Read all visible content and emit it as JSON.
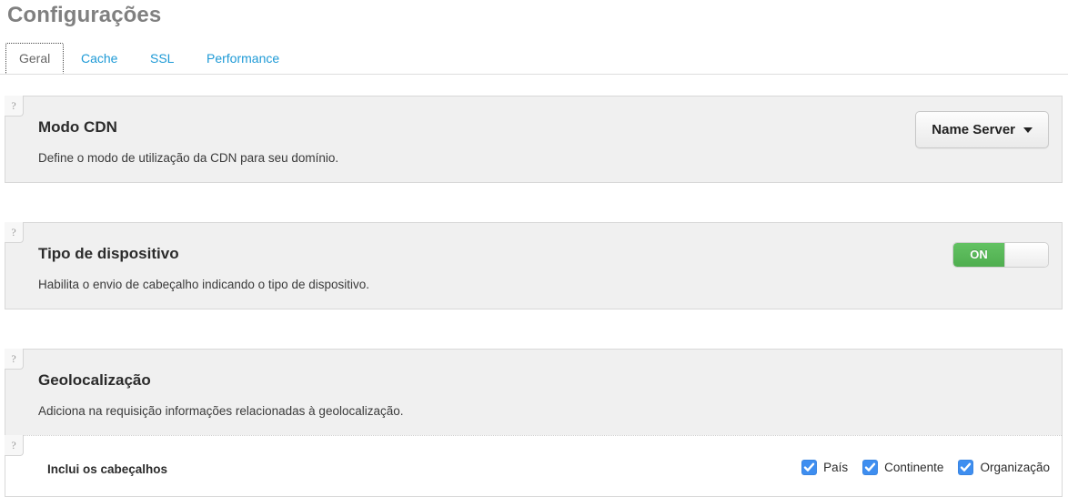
{
  "header": {
    "title": "Configurações"
  },
  "tabs": [
    {
      "label": "Geral",
      "active": true
    },
    {
      "label": "Cache",
      "active": false
    },
    {
      "label": "SSL",
      "active": false
    },
    {
      "label": "Performance",
      "active": false
    }
  ],
  "help_badge": {
    "glyph": "?"
  },
  "panels": [
    {
      "title": "Modo CDN",
      "description": "Define o modo de utilização da CDN para seu domínio.",
      "control": {
        "type": "dropdown",
        "value": "Name Server"
      }
    },
    {
      "title": "Tipo de dispositivo",
      "description": "Habilita o envio de cabeçalho indicando o tipo de dispositivo.",
      "control": {
        "type": "toggle",
        "state": "ON",
        "on_label": "ON"
      }
    },
    {
      "title": "Geolocalização",
      "description": "Adiciona na requisição informações relacionadas à geolocalização.",
      "subrow": {
        "label": "Inclui os cabeçalhos",
        "checkboxes": [
          {
            "label": "País",
            "checked": true
          },
          {
            "label": "Continente",
            "checked": true
          },
          {
            "label": "Organização",
            "checked": true
          }
        ]
      }
    }
  ],
  "colors": {
    "title_gray": "#808080",
    "link_blue": "#1e9ad6",
    "panel_bg": "#f0f0f0",
    "panel_border": "#d8d8d8",
    "toggle_green": "#4fae4f",
    "checkbox_blue": "#3e8ef0"
  }
}
